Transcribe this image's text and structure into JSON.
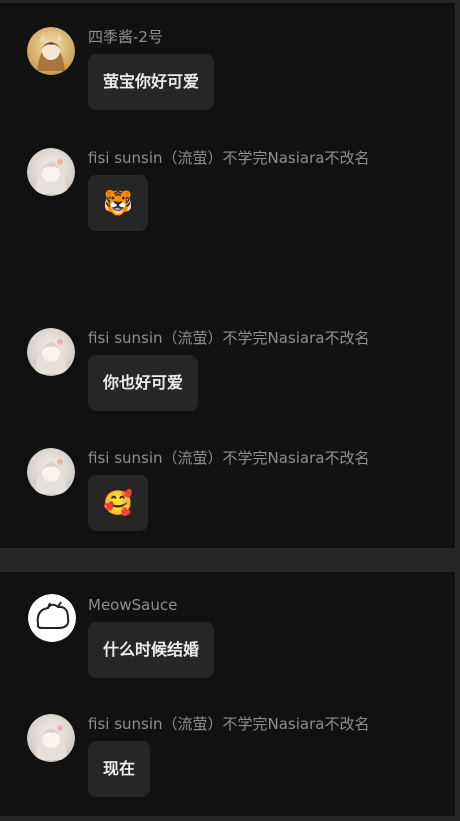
{
  "chat": {
    "panel1": [
      {
        "sender": "四季酱-2号",
        "text": "萤宝你好可爱",
        "avatar_icon": "girl-anime-avatar"
      },
      {
        "sender": "fisi sunsin（流萤）不学完Nasiara不改名",
        "text": "🐯",
        "avatar_icon": "white-hair-anime-avatar"
      },
      {
        "sender": "fisi sunsin（流萤）不学完Nasiara不改名",
        "text": "你也好可爱",
        "avatar_icon": "white-hair-anime-avatar"
      },
      {
        "sender": "fisi sunsin（流萤）不学完Nasiara不改名",
        "text": "🥰",
        "avatar_icon": "white-hair-anime-avatar"
      }
    ],
    "panel2": [
      {
        "sender": "MeowSauce",
        "text": "什么时候结婚",
        "avatar_icon": "cat-outline-avatar"
      },
      {
        "sender": "fisi sunsin（流萤）不学完Nasiara不改名",
        "text": "现在",
        "avatar_icon": "white-hair-anime-avatar"
      }
    ]
  },
  "colors": {
    "panel_bg": "#111111",
    "page_bg": "#262626",
    "bubble_bg": "#262626",
    "sender_text": "#8e8e8e",
    "message_text": "#ececec"
  }
}
